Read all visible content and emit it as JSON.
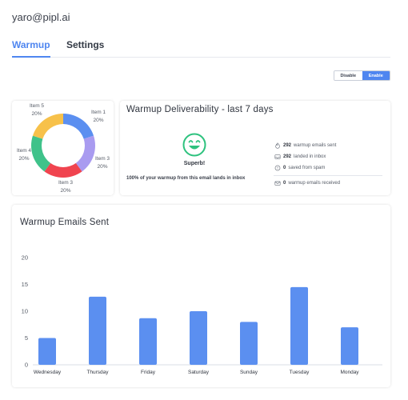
{
  "account": {
    "email": "yaro@pipl.ai"
  },
  "tabs": [
    {
      "label": "Warmup",
      "active": true
    },
    {
      "label": "Settings",
      "active": false
    }
  ],
  "toggle": {
    "disable_label": "Disable",
    "enable_label": "Enable",
    "selected": "Enable"
  },
  "colors": {
    "accent": "#4f86f0",
    "success": "#2ec27e"
  },
  "donut": {
    "items": [
      {
        "label": "Item 1",
        "percent": "20%",
        "value": 20,
        "color": "#5b8ff0"
      },
      {
        "label": "Item 3",
        "percent": "20%",
        "value": 20,
        "color": "#a99bf0"
      },
      {
        "label": "Item 3",
        "percent": "20%",
        "value": 20,
        "color": "#f0444f"
      },
      {
        "label": "Item 4",
        "percent": "20%",
        "value": 20,
        "color": "#3fc28a"
      },
      {
        "label": "Item 5",
        "percent": "20%",
        "value": 20,
        "color": "#f7c14a"
      }
    ]
  },
  "deliverability": {
    "title": "Warmup Deliverability - last 7 days",
    "status_label": "Superb!",
    "status_icon": "smile-icon",
    "inbox_message": "100% of your warmup from this email lands in inbox",
    "stats": [
      {
        "value": "292",
        "label": "warmup emails sent",
        "icon": "fire-icon"
      },
      {
        "value": "292",
        "label": "landed in inbox",
        "icon": "inbox-icon"
      },
      {
        "value": "0",
        "label": "saved from spam",
        "icon": "shield-icon"
      },
      {
        "value": "0",
        "label": "warmup emails received",
        "icon": "envelope-icon"
      }
    ]
  },
  "chart_title": "Warmup Emails Sent",
  "chart_data": {
    "type": "bar",
    "title": "Warmup Emails Sent",
    "categories": [
      "Wednesday",
      "Thursday",
      "Friday",
      "Saturday",
      "Sunday",
      "Tuesday",
      "Monday"
    ],
    "values": [
      5,
      12.7,
      8.7,
      10,
      8,
      14.5,
      7
    ],
    "ylim": [
      0,
      20
    ],
    "yticks": [
      "0",
      "5",
      "10",
      "15",
      "20"
    ],
    "grid": false,
    "bar_color": "#5b8ff0"
  }
}
